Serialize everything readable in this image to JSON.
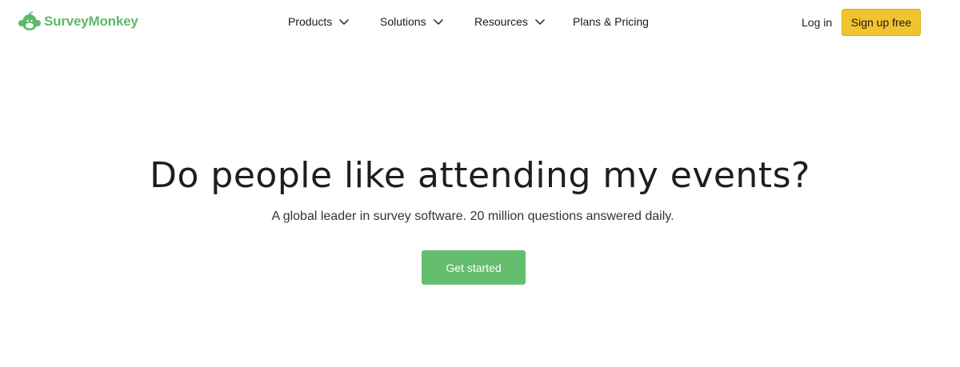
{
  "header": {
    "logo": {
      "text": "SurveyMonkey",
      "icon": "surveymonkey-logo-icon",
      "color": "#5cba67"
    },
    "nav": {
      "products": "Products",
      "solutions": "Solutions",
      "resources": "Resources",
      "pricing": "Plans & Pricing"
    },
    "login_label": "Log in",
    "signup_label": "Sign up free",
    "signup_color": "#f1c32f"
  },
  "hero": {
    "title": "Do people like attending my events?",
    "subtitle": "A global leader in survey software. 20 million questions answered daily.",
    "cta_label": "Get started",
    "cta_color": "#64be6e"
  }
}
